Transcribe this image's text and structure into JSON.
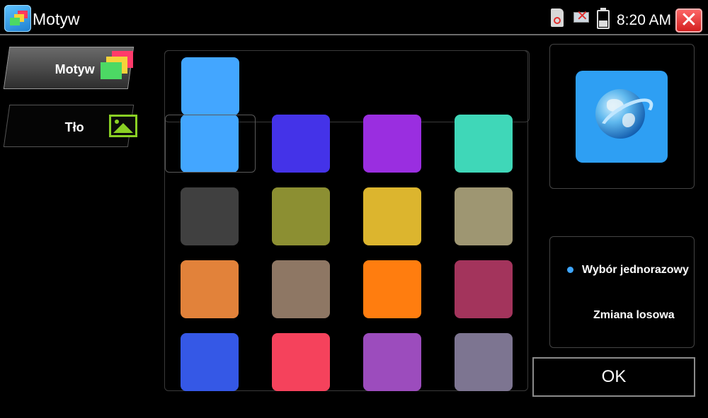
{
  "titlebar": {
    "title": "Motyw",
    "time": "8:20 AM",
    "icons": [
      "app-theme-icon",
      "sd-card-icon",
      "network-disconnected-icon",
      "battery-icon",
      "close-icon"
    ]
  },
  "tabs": [
    {
      "label": "Motyw",
      "icon": "theme-squares-icon",
      "active": true
    },
    {
      "label": "Tło",
      "icon": "image-icon",
      "active": false
    }
  ],
  "selected_color": "#43a6ff",
  "swatches": [
    "#43a6ff",
    "#4433e8",
    "#9a2ee0",
    "#3fd7b8",
    "#404040",
    "#8c8f32",
    "#dcb52e",
    "#9e9672",
    "#e2823a",
    "#8e7764",
    "#ff7d0f",
    "#a3345c",
    "#3558e6",
    "#f5425c",
    "#9c4cbd",
    "#7d7591"
  ],
  "preview_icon": "browser-globe-icon",
  "modes": {
    "selected": "Wybór jednorazowy",
    "options": [
      "Wybór jednorazowy",
      "Zmiana losowa"
    ]
  },
  "ok_label": "OK"
}
